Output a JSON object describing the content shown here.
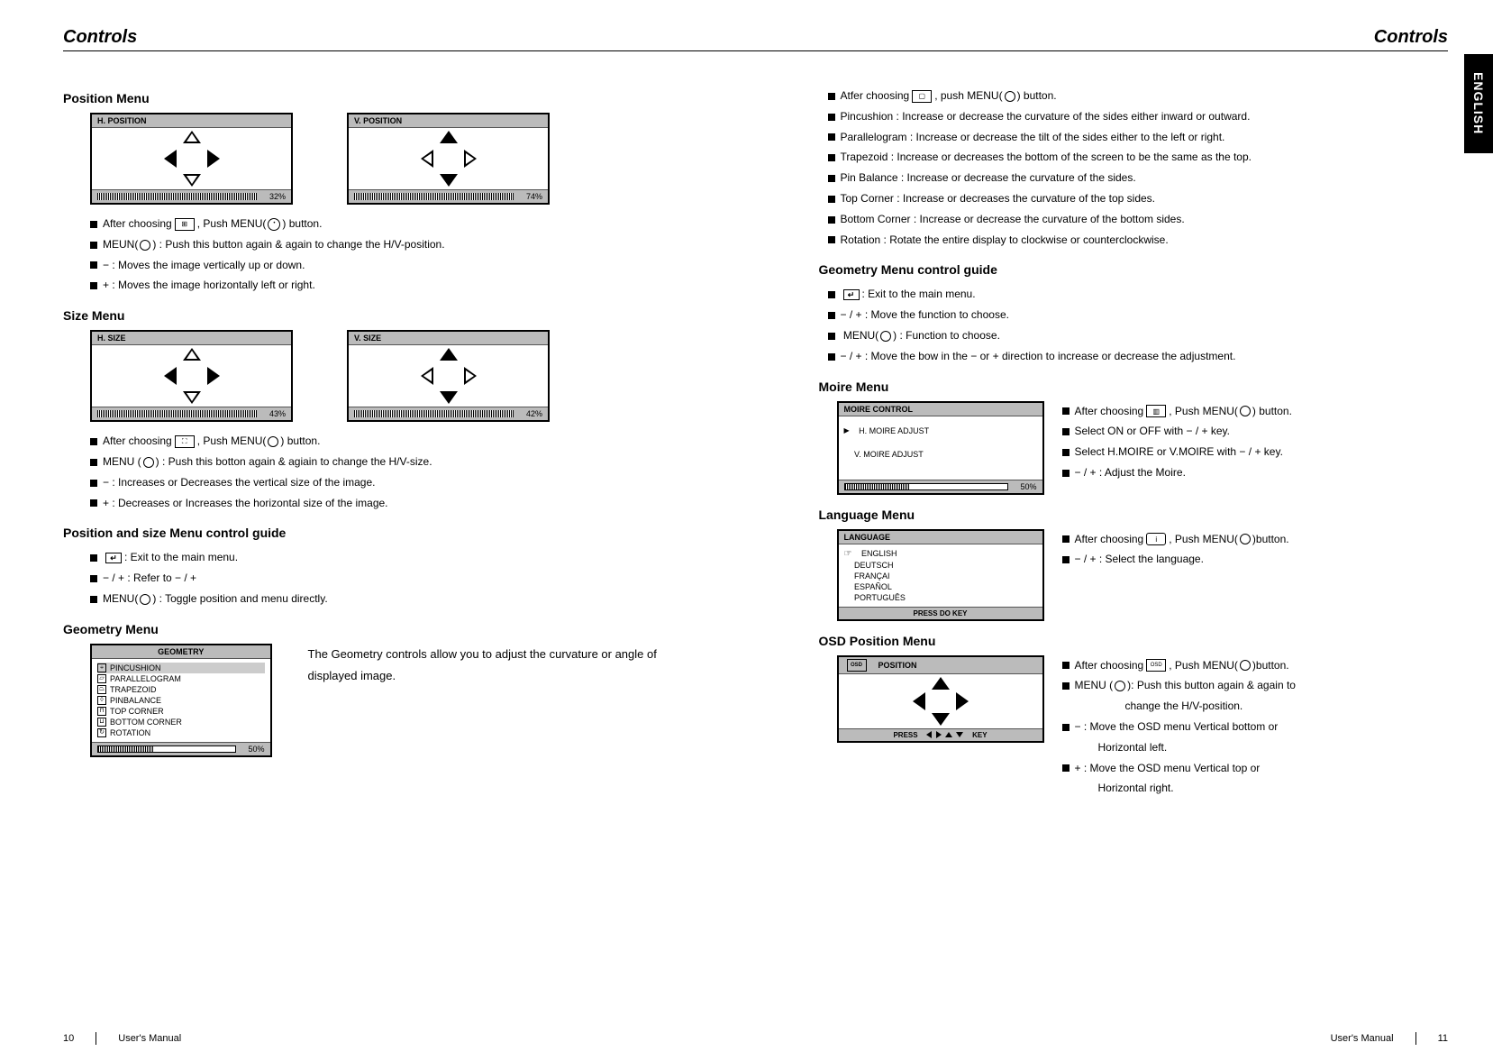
{
  "header": {
    "left": "Controls",
    "right": "Controls"
  },
  "langTab": "ENGLISH",
  "left": {
    "position": {
      "title": "Position Menu",
      "h": {
        "label": "H. POSITION",
        "pct": "32%"
      },
      "v": {
        "label": "V. POSITION",
        "pct": "74%"
      },
      "b1": "After choosing",
      "b1b": ", Push MENU(",
      "b1c": ") button.",
      "b2a": "MEUN(",
      "b2b": ") : Push this button again & again to change the H/V-position.",
      "b3": "−   : Moves the image vertically up or down.",
      "b4": "+   : Moves the image horizontally left or right."
    },
    "size": {
      "title": "Size Menu",
      "h": {
        "label": "H. SIZE",
        "pct": "43%"
      },
      "v": {
        "label": "V. SIZE",
        "pct": "42%"
      },
      "b1": "After choosing",
      "b1b": ", Push MENU(",
      "b1c": ") button.",
      "b2a": "MENU (",
      "b2b": ") : Push this botton again & agiain to change the H/V-size.",
      "b3": "−  : Increases or Decreases the vertical size of the image.",
      "b4": "+  : Decreases or Increases the horizontal size of the image."
    },
    "guide1": {
      "title": "Position and size Menu control guide",
      "b1": ": Exit to the main menu.",
      "b2": "−  / +   : Refer to  −   / +",
      "b3a": "MENU(",
      "b3b": ") : Toggle position and menu directly."
    },
    "geometry": {
      "title": "Geometry Menu",
      "header": "GEOMETRY",
      "items": [
        "PINCUSHION",
        "PARALLELOGRAM",
        "TRAPEZOID",
        "PINBALANCE",
        "TOP CORNER",
        "BOTTOM CORNER",
        "ROTATION"
      ],
      "pct": "50%",
      "desc": "The Geometry controls allow you to adjust the curvature or angle of displayed image."
    }
  },
  "right": {
    "geoBullets": {
      "b1a": "Atfer choosing",
      "b1b": ", push MENU(",
      "b1c": ") button.",
      "b2": "Pincushion : Increase or decrease the curvature of the sides either inward or outward.",
      "b3": "Parallelogram : Increase or decrease the tilt of the sides either to the left or right.",
      "b4": "Trapezoid : Increase or decreases the bottom of the screen to be the same as the top.",
      "b5": "Pin Balance : Increase or decrease the curvature of the sides.",
      "b6": "Top Corner : Increase or decreases the curvature of the top sides.",
      "b7": "Bottom Corner : Increase or decrease the curvature of the bottom sides.",
      "b8": "Rotation : Rotate the entire display to clockwise or counterclockwise."
    },
    "geoGuide": {
      "title": "Geometry Menu control guide",
      "b1": ": Exit to the main menu.",
      "b2": "−   / +   : Move the function to choose.",
      "b3a": "MENU(",
      "b3b": ") : Function to choose.",
      "b4": "−   / +   : Move the bow in the   −  or    +  direction to increase or decrease the adjustment."
    },
    "moire": {
      "title": "Moire Menu",
      "header": "MOIRE CONTROL",
      "i1": "H. MOIRE ADJUST",
      "i2": "V. MOIRE ADJUST",
      "pct": "50%",
      "b1a": "After choosing",
      "b1b": ", Push MENU(",
      "b1c": ") button.",
      "b2": "Select ON or OFF with  −  / +   key.",
      "b3": "Select H.MOIRE or V.MOIRE with −   / +    key.",
      "b4": "−  / +  : Adjust the Moire."
    },
    "language": {
      "title": "Language Menu",
      "header": "LANGUAGE",
      "items": [
        "ENGLISH",
        "DEUTSCH",
        "FRANÇAI",
        "ESPAÑOL",
        "PORTUGUÊS"
      ],
      "press": "PRESS DO KEY",
      "b1a": "After choosing",
      "b1b": ", Push MENU(",
      "b1c": ")button.",
      "b2": "−  / +  : Select the language."
    },
    "osdpos": {
      "title": "OSD Position Menu",
      "header": "POSITION",
      "press1": "PRESS",
      "press2": "KEY",
      "b1a": "After choosing",
      "b1b": ", Push MENU(",
      "b1c": ")button.",
      "b2a": "MENU (",
      "b2b": "): Push this button again & again to",
      "b2c": "change the H/V-position.",
      "b3": "−   : Move the OSD menu Vertical bottom or",
      "b3b": "Horizontal left.",
      "b4": "+   : Move the OSD menu Vertical top or",
      "b4b": "Horizontal right."
    }
  },
  "footer": {
    "leftNum": "10",
    "leftText": "User's Manual",
    "rightText": "User's Manual",
    "rightNum": "11"
  }
}
